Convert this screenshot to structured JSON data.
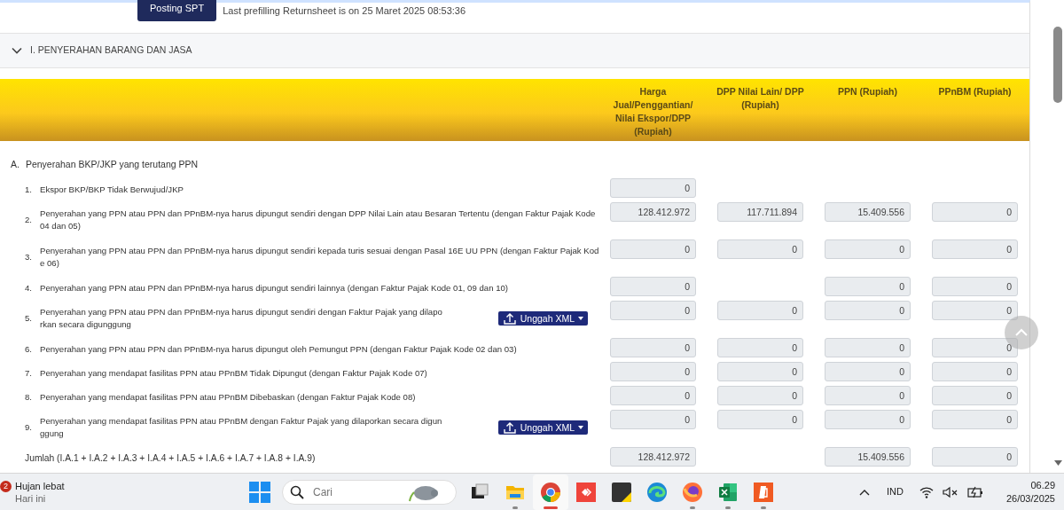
{
  "top_bar": {
    "button": "Posting SPT",
    "info": "Last prefilling Returnsheet is on 25 Maret 2025 08:53:36"
  },
  "section": {
    "title": "I. PENYERAHAN BARANG DAN JASA",
    "expanded": true
  },
  "table": {
    "columns": [
      "Harga Jual/Penggantian/ Nilai Ekspor/DPP (Rupiah)",
      "DPP Nilai Lain/ DPP (Rupiah)",
      "PPN (Rupiah)",
      "PPnBM (Rupiah)"
    ],
    "group": {
      "number": "A.",
      "text": "Penyerahan BKP/JKP yang terutang PPN"
    },
    "rows": [
      {
        "number": "1.",
        "lines": [
          "Ekspor BKP/BKP Tidak Berwujud/JKP"
        ],
        "values": {
          "harga_jual": "0"
        }
      },
      {
        "number": "2.",
        "lines": [
          "Penyerahan yang PPN atau PPN dan PPnBM-nya harus dipungut sendiri dengan DPP Nilai Lain atau Besaran Tertentu (dengan Faktur Pajak Kode",
          "04 dan 05)"
        ],
        "values": {
          "harga_jual": "128.412.972",
          "dpp_nilai_lain": "117.711.894",
          "ppn": "15.409.556",
          "ppnbm": "0"
        }
      },
      {
        "number": "3.",
        "lines": [
          "Penyerahan yang PPN atau PPN dan PPnBM-nya harus dipungut sendiri kepada turis sesuai dengan Pasal 16E UU PPN (dengan Faktur Pajak Kod",
          "e 06)"
        ],
        "values": {
          "harga_jual": "0",
          "dpp_nilai_lain": "0",
          "ppn": "0",
          "ppnbm": "0"
        }
      },
      {
        "number": "4.",
        "lines": [
          "Penyerahan yang PPN atau PPN dan PPnBM-nya harus dipungut sendiri lainnya (dengan Faktur Pajak Kode 01, 09 dan 10)"
        ],
        "values": {
          "harga_jual": "0",
          "ppn": "0",
          "ppnbm": "0"
        }
      },
      {
        "number": "5.",
        "lines": [
          "Penyerahan yang PPN atau PPN dan PPnBM-nya harus dipungut sendiri dengan Faktur Pajak yang dilapo",
          "rkan secara digunggung"
        ],
        "upload": "Unggah XML",
        "values": {
          "harga_jual": "0",
          "dpp_nilai_lain": "0",
          "ppn": "0",
          "ppnbm": "0"
        }
      },
      {
        "number": "6.",
        "lines": [
          "Penyerahan yang PPN atau PPN dan PPnBM-nya harus dipungut oleh Pemungut PPN (dengan Faktur Pajak Kode 02 dan 03)"
        ],
        "values": {
          "harga_jual": "0",
          "dpp_nilai_lain": "0",
          "ppn": "0",
          "ppnbm": "0"
        }
      },
      {
        "number": "7.",
        "lines": [
          "Penyerahan yang mendapat fasilitas PPN atau PPnBM Tidak Dipungut (dengan Faktur Pajak Kode 07)"
        ],
        "values": {
          "harga_jual": "0",
          "dpp_nilai_lain": "0",
          "ppn": "0",
          "ppnbm": "0"
        }
      },
      {
        "number": "8.",
        "lines": [
          "Penyerahan yang mendapat fasilitas PPN atau PPnBM Dibebaskan (dengan Faktur Pajak Kode 08)"
        ],
        "values": {
          "harga_jual": "0",
          "dpp_nilai_lain": "0",
          "ppn": "0",
          "ppnbm": "0"
        }
      },
      {
        "number": "9.",
        "lines": [
          "Penyerahan yang mendapat fasilitas PPN atau PPnBM dengan Faktur Pajak yang dilaporkan secara digun",
          "ggung"
        ],
        "upload": "Unggah XML",
        "values": {
          "harga_jual": "0",
          "dpp_nilai_lain": "0",
          "ppn": "0",
          "ppnbm": "0"
        }
      }
    ],
    "total": {
      "label": "Jumlah (I.A.1 + I.A.2 + I.A.3 + I.A.4 + I.A.5 + I.A.6 + I.A.7 + I.A.8 + I.A.9)",
      "values": {
        "harga_jual": "128.412.972",
        "ppn": "15.409.556",
        "ppnbm": "0"
      }
    }
  },
  "taskbar": {
    "weather": {
      "badge": "2",
      "title": "Hujan lebat",
      "subtitle": "Hari ini"
    },
    "search": {
      "placeholder": "Cari"
    },
    "apps": [
      {
        "kind": "task-view",
        "selected": false,
        "running": false
      },
      {
        "kind": "folder",
        "selected": false,
        "running": true
      },
      {
        "kind": "browser-ring",
        "selected": true,
        "running": true
      },
      {
        "kind": "diamond-app",
        "selected": false,
        "running": false
      },
      {
        "kind": "notes",
        "selected": false,
        "running": false
      },
      {
        "kind": "wave-browser",
        "selected": false,
        "running": false
      },
      {
        "kind": "fox-browser",
        "selected": false,
        "running": true
      },
      {
        "kind": "spreadsheet",
        "selected": false,
        "running": true
      },
      {
        "kind": "document",
        "selected": false,
        "running": true
      }
    ],
    "tray": {
      "language": "IND",
      "time": "06.29",
      "date": "26/03/2025"
    }
  }
}
